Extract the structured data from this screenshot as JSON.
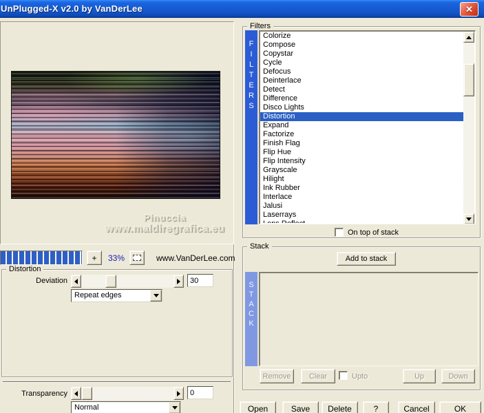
{
  "window": {
    "title": "UnPlugged-X v2.0 by VanDerLee",
    "close_glyph": "✕"
  },
  "preview": {
    "watermark_line1": "Pinuccia",
    "watermark_line2": "www.maldiregrafica.eu"
  },
  "toolbar": {
    "zoom_in_label": "+",
    "zoom_percent": "33%",
    "website": "www.VanDerLee.com"
  },
  "distortion": {
    "group_label": "Distortion",
    "deviation_label": "Deviation",
    "deviation_value": "30",
    "edge_mode_value": "Repeat edges"
  },
  "blend": {
    "transparency_label": "Transparency",
    "transparency_value": "0",
    "mode_value": "Normal"
  },
  "filters": {
    "group_label": "Filters",
    "sidebar_letters": [
      "F",
      "I",
      "L",
      "T",
      "E",
      "R",
      "S"
    ],
    "items": [
      "Colorize",
      "Compose",
      "Copystar",
      "Cycle",
      "Defocus",
      "Deinterlace",
      "Detect",
      "Difference",
      "Disco Lights",
      "Distortion",
      "Expand",
      "Factorize",
      "Finish Flag",
      "Flip Hue",
      "Flip Intensity",
      "Grayscale",
      "Hilight",
      "Ink Rubber",
      "Interlace",
      "Jalusi",
      "Laserrays",
      "Lens Reflect"
    ],
    "selected": "Distortion",
    "on_top_label": "On top of stack"
  },
  "stack": {
    "group_label": "Stack",
    "add_button_label": "Add to stack",
    "sidebar_letters": [
      "S",
      "T",
      "A",
      "C",
      "K"
    ],
    "items": [],
    "remove_label": "Remove",
    "clear_label": "Clear",
    "upto_label": "Upto",
    "up_label": "Up",
    "down_label": "Down"
  },
  "actions": {
    "open_label": "Open",
    "save_label": "Save",
    "delete_label": "Delete",
    "help_label": "?",
    "cancel_label": "Cancel",
    "ok_label": "OK"
  },
  "colors": {
    "titlebar_blue": "#1A5CD8",
    "selection_blue": "#2A5FC4",
    "filters_bar_blue": "#2C5CD5",
    "stack_bar_blue": "#8098E2",
    "progress_block_blue": "#2E5FC6",
    "zoom_percent_text": "#1A1AB8",
    "dialog_face": "#ECE9D8"
  }
}
